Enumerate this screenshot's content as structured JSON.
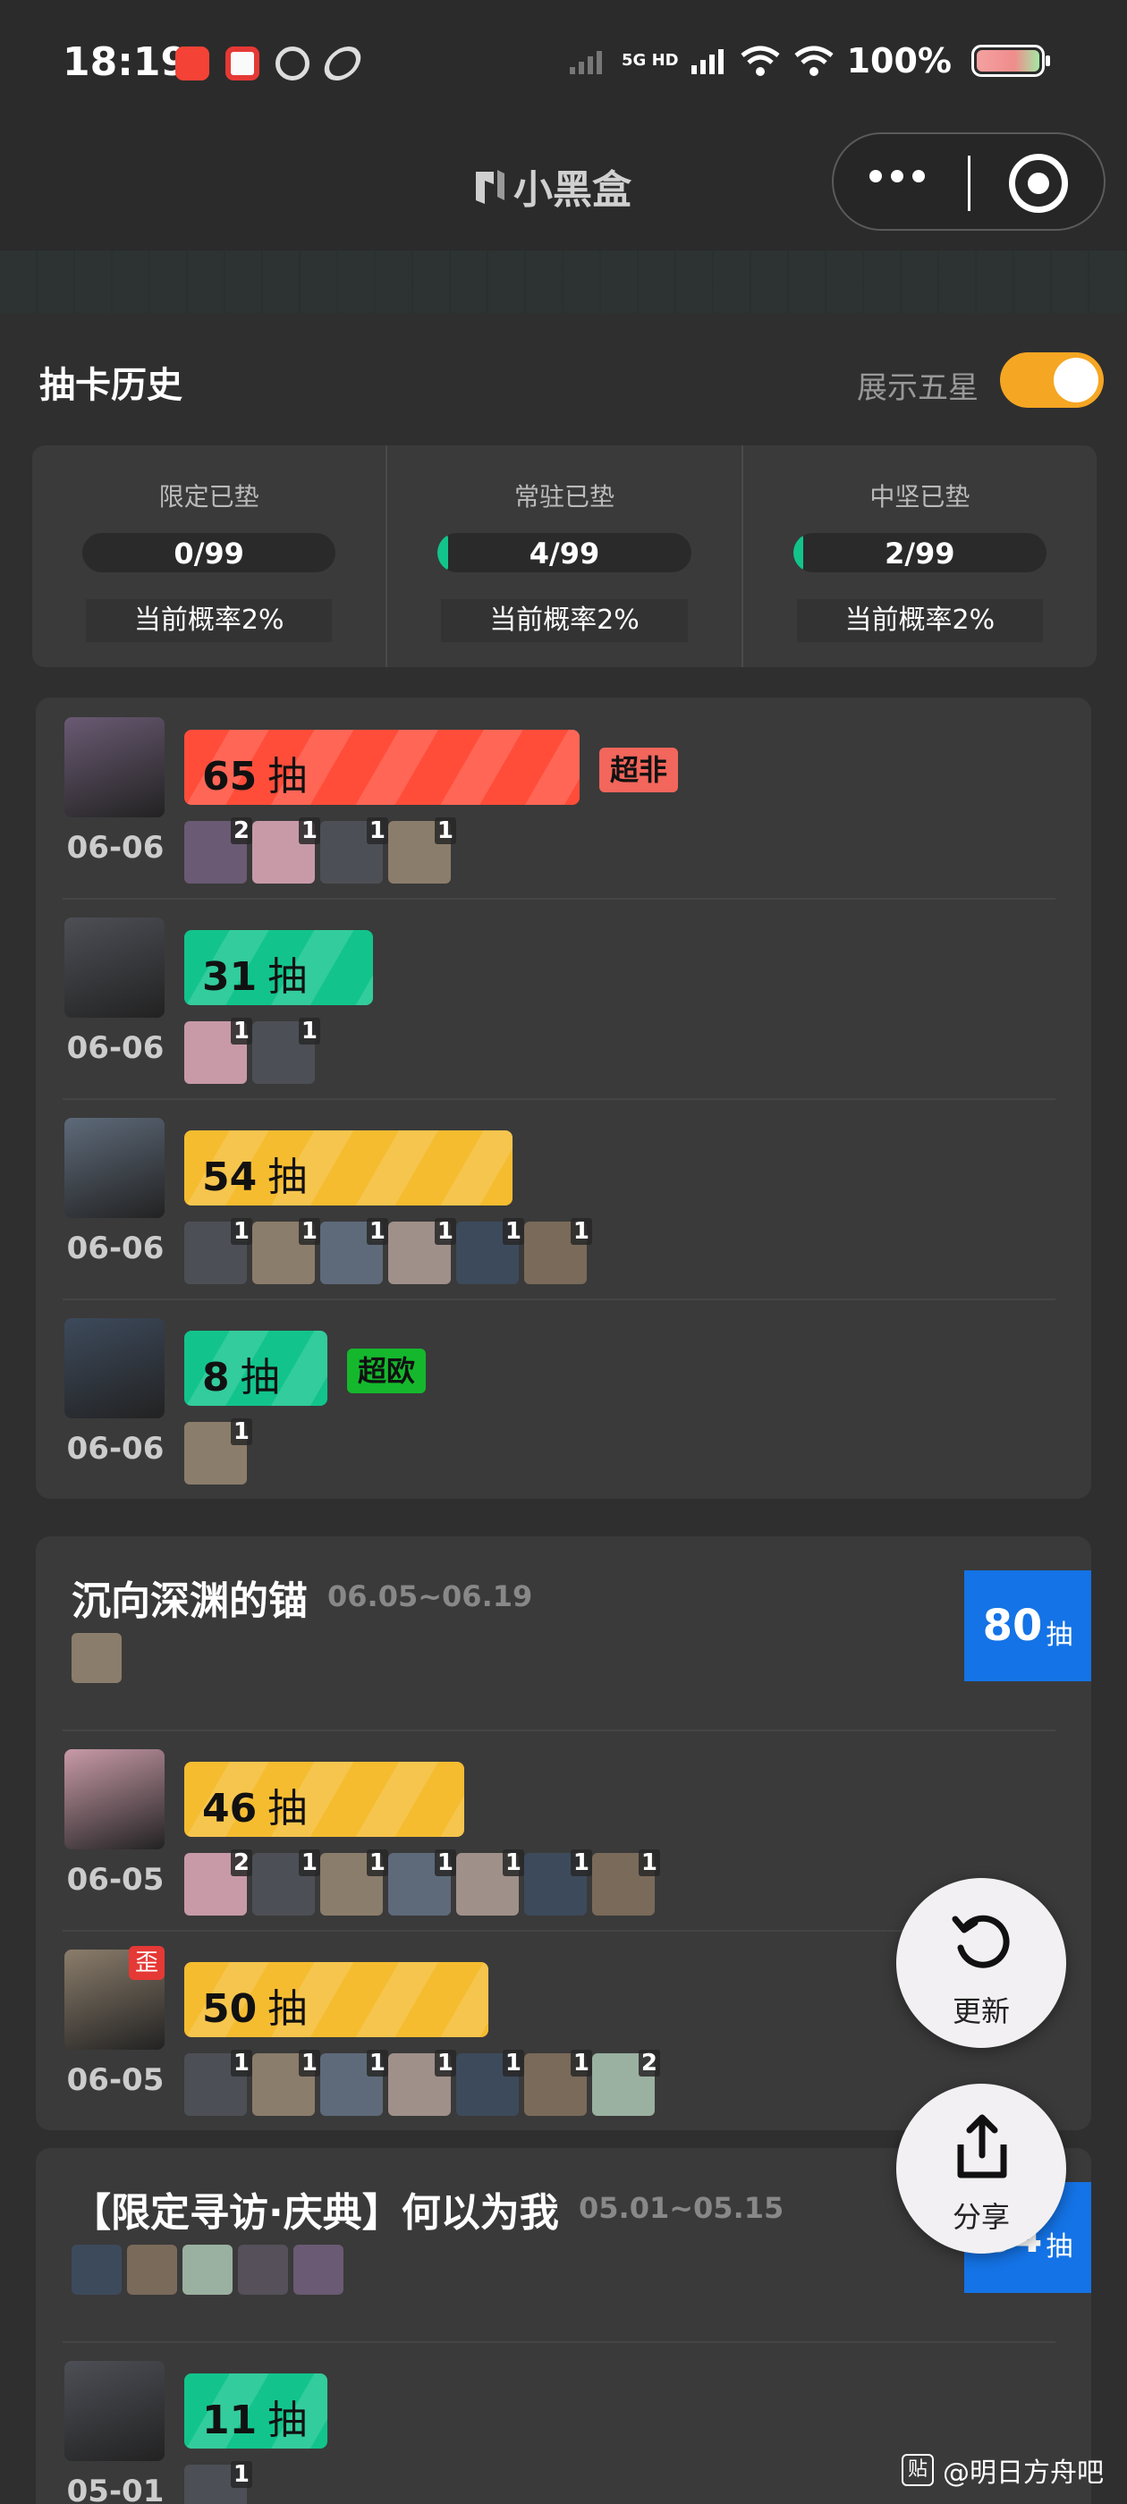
{
  "status_bar": {
    "time": "18:19",
    "network": "5G HD",
    "battery": "100%"
  },
  "title_bar": {
    "title": "小黑盒",
    "more_icon": "more-dots-icon",
    "close_icon": "target-close-icon"
  },
  "header": {
    "title": "抽卡历史",
    "toggle_label": "展示五星",
    "toggle_on": true
  },
  "stats": [
    {
      "label": "限定已垫",
      "value": "0/99",
      "progress": 0,
      "rate": "当前概率2%"
    },
    {
      "label": "常驻已垫",
      "value": "4/99",
      "progress": 0.04,
      "rate": "当前概率2%"
    },
    {
      "label": "中坚已垫",
      "value": "2/99",
      "progress": 0.02,
      "rate": "当前概率2%"
    }
  ],
  "colors": {
    "red": "#ff4d3a",
    "green": "#12c48c",
    "yellow": "#f5bc30",
    "blue": "#1473e6",
    "tag_bad": "#f2665b",
    "tag_good": "#15b82d"
  },
  "unit": "抽",
  "cards": [
    {
      "entries": [
        {
          "date": "06-06",
          "count": "65",
          "fraction": 0.65,
          "color": "red",
          "tag": "超非",
          "tag_color": "tag_bad",
          "minis": [
            "2",
            "1",
            "1",
            "1"
          ]
        },
        {
          "date": "06-06",
          "count": "31",
          "fraction": 0.31,
          "color": "green",
          "minis": [
            "1",
            "1"
          ]
        },
        {
          "date": "06-06",
          "count": "54",
          "fraction": 0.54,
          "color": "yellow",
          "minis": [
            "1",
            "1",
            "1",
            "1",
            "1",
            "1"
          ]
        },
        {
          "date": "06-06",
          "count": "8",
          "fraction": 0.08,
          "color": "green",
          "tag": "超欧",
          "tag_color": "tag_good",
          "minis": [
            "1"
          ]
        }
      ]
    },
    {
      "banner": {
        "title": "沉向深渊的锚",
        "dates": "06.05~06.19",
        "total": "80",
        "total_unit": "抽",
        "icons": 1
      },
      "entries": [
        {
          "date": "06-05",
          "count": "46",
          "fraction": 0.46,
          "color": "yellow",
          "minis": [
            "2",
            "1",
            "1",
            "1",
            "1",
            "1",
            "1"
          ]
        },
        {
          "date": "06-05",
          "count": "50",
          "fraction": 0.5,
          "color": "yellow",
          "wai": "歪",
          "minis": [
            "1",
            "1",
            "1",
            "1",
            "1",
            "1",
            "2"
          ]
        }
      ]
    },
    {
      "banner": {
        "title": "【限定寻访·庆典】何以为我",
        "dates": "05.01~05.15",
        "total": "64",
        "total_unit": "抽",
        "icons": 5
      },
      "entries": [
        {
          "date": "05-01",
          "count": "11",
          "fraction": 0.11,
          "color": "green",
          "minis": [
            "1"
          ]
        }
      ]
    }
  ],
  "fab": {
    "refresh_label": "更新",
    "share_label": "分享"
  },
  "watermark": "@明日方舟吧",
  "watermark_icon": "贴"
}
